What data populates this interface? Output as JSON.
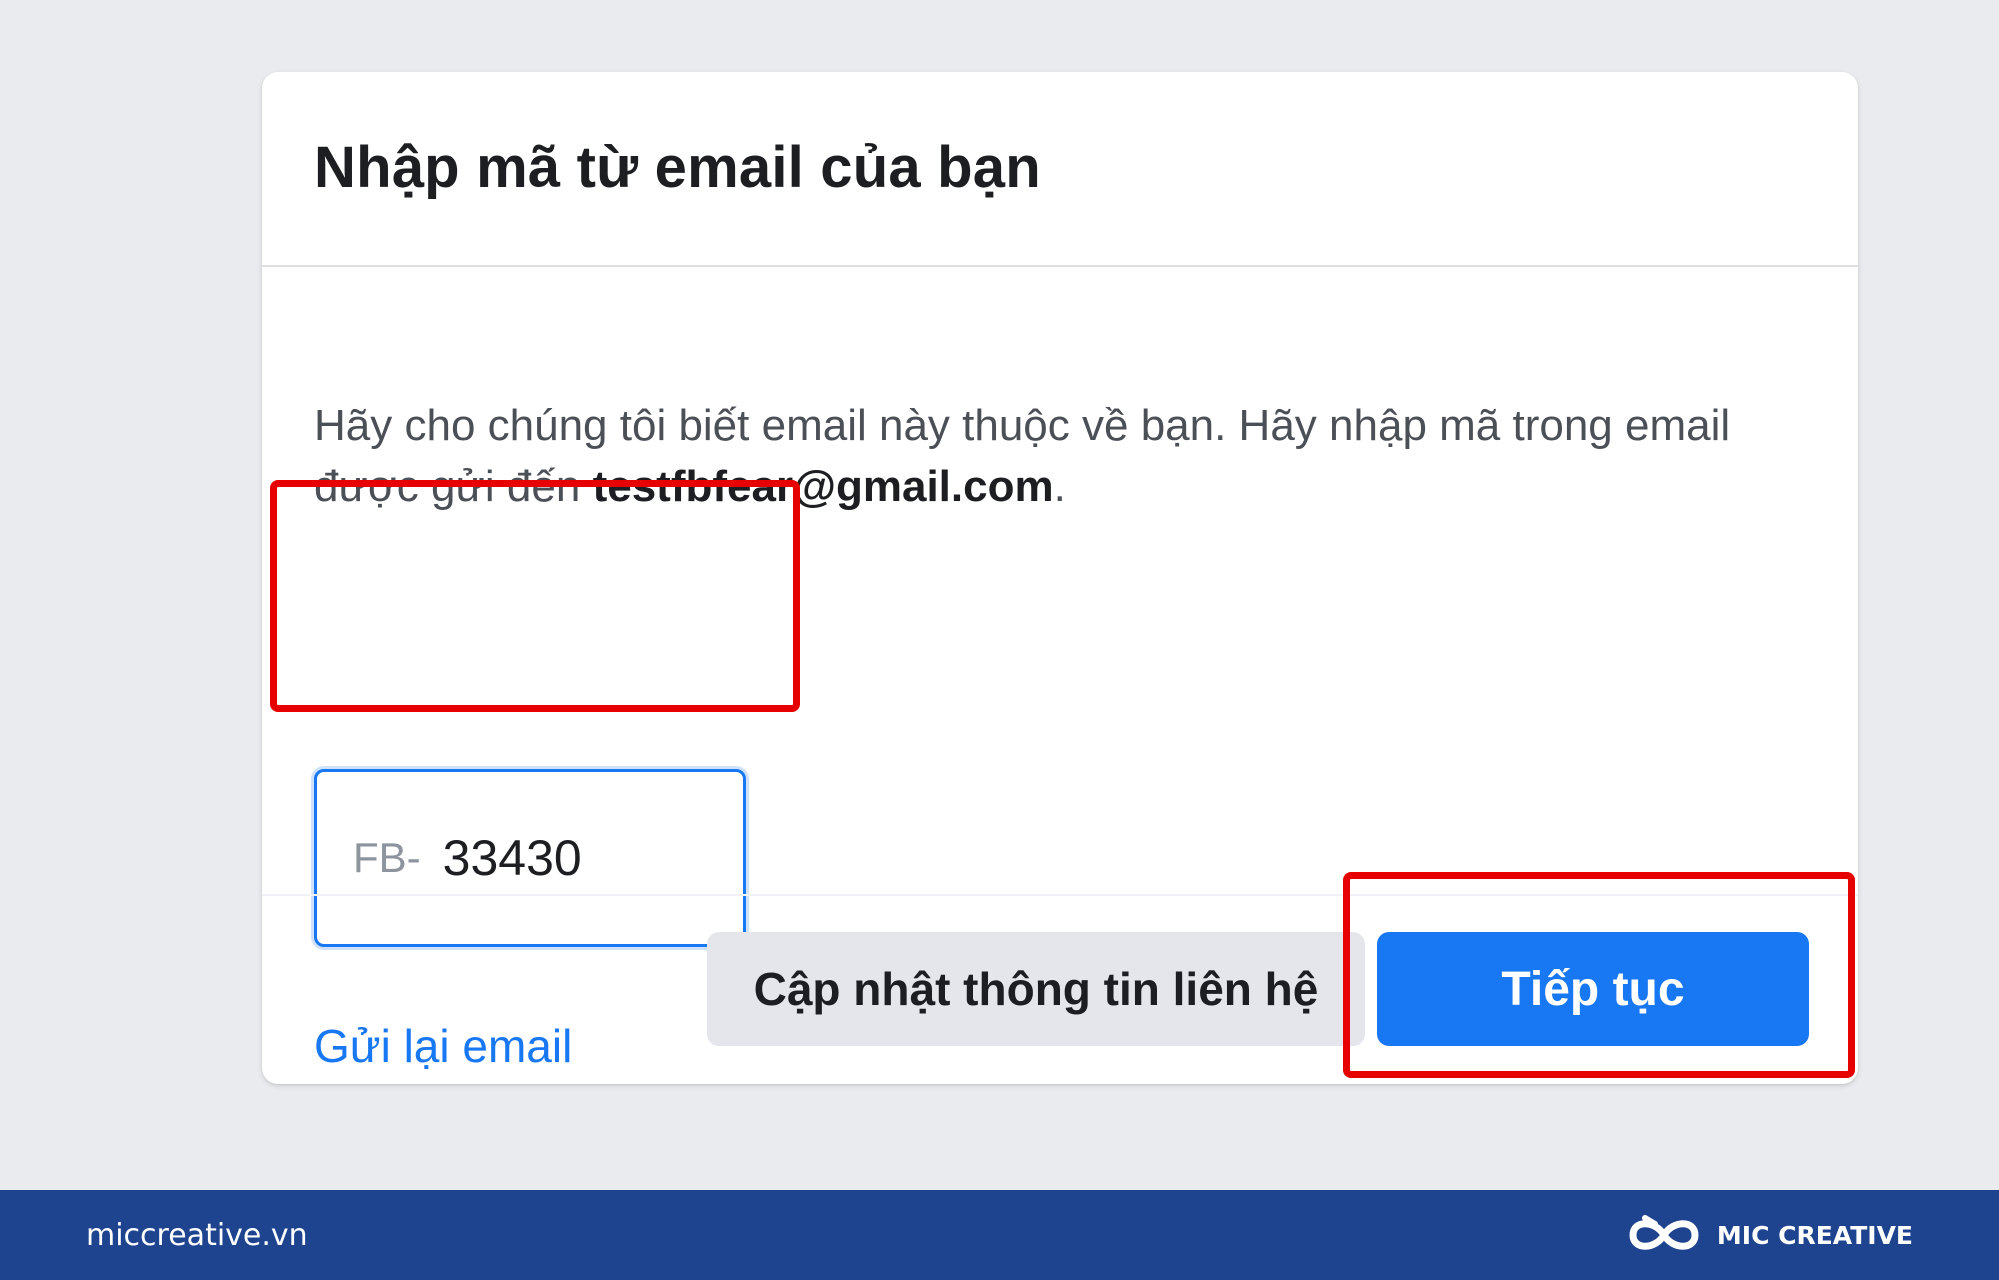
{
  "dialog": {
    "title": "Nhập mã từ email của bạn",
    "description_prefix": "Hãy cho chúng tôi biết email này thuộc về bạn. Hãy nhập mã trong email được gửi đến ",
    "email": "testfbfear@gmail.com",
    "description_suffix": ".",
    "code_prefix": "FB-",
    "code_value": "33430",
    "resend_link": "Gửi lại email",
    "update_contact_button": "Cập nhật thông tin liên hệ",
    "continue_button": "Tiếp tục"
  },
  "footer": {
    "site": "miccreative.vn",
    "brand": "MIC CREATIVE"
  },
  "colors": {
    "primary": "#1877f2",
    "highlight": "#e60000",
    "footer_bg": "#1e4490"
  }
}
